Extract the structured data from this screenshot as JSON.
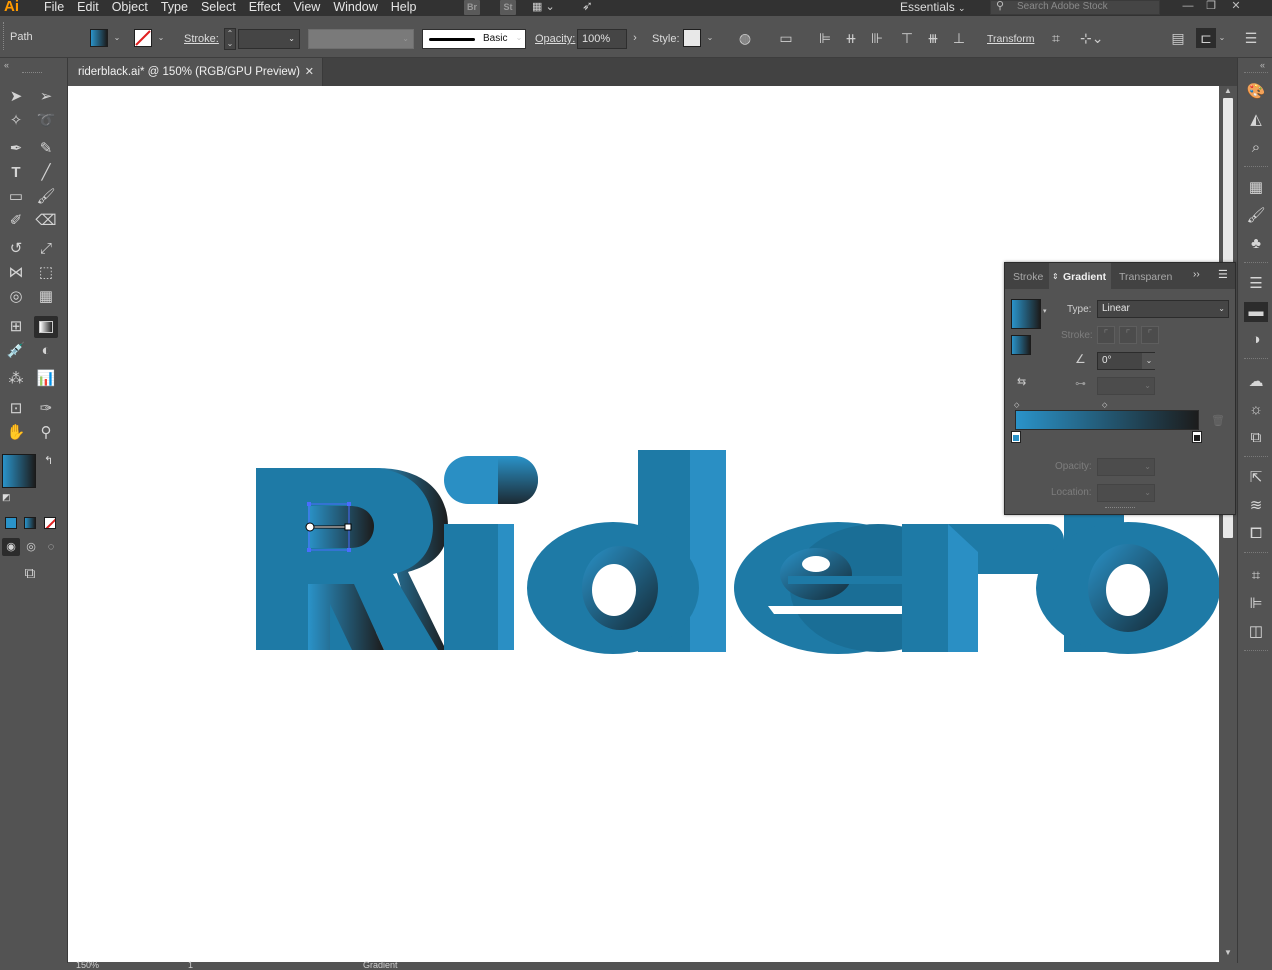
{
  "app": {
    "logo": "Ai",
    "menu": [
      "File",
      "Edit",
      "Object",
      "Type",
      "Select",
      "Effect",
      "View",
      "Window",
      "Help"
    ],
    "bridge_label": "Br",
    "stock_label": "St",
    "workspace": "Essentials",
    "search_placeholder": "Search Adobe Stock"
  },
  "control_bar": {
    "selection_type": "Path",
    "stroke_label": "Stroke:",
    "brush_label": "Basic",
    "opacity_label": "Opacity:",
    "opacity_value": "100%",
    "style_label": "Style:",
    "transform_label": "Transform"
  },
  "document": {
    "tab_title": "riderblack.ai* @ 150% (RGB/GPU Preview)",
    "artwork_text": "Riderb",
    "zoom": "150%",
    "artboard_number": "1",
    "status_tool": "Gradient"
  },
  "gradient_panel": {
    "tabs": [
      "Stroke",
      "Gradient",
      "Transparen"
    ],
    "selected_tab": "Gradient",
    "type_label": "Type:",
    "type_value": "Linear",
    "stroke_label": "Stroke:",
    "angle_value": "0°",
    "opacity_label": "Opacity:",
    "location_label": "Location:"
  },
  "colors": {
    "gradient_start": "#2a93c9",
    "gradient_end": "#1c1c1c",
    "artwork_blue": "#1e7aa6",
    "artwork_highlight": "#2a8fc4",
    "ui_bg": "#535353",
    "menubar_bg": "#323232"
  }
}
